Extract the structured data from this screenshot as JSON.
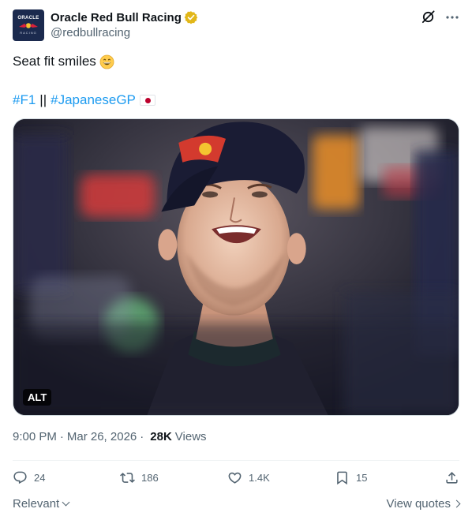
{
  "account": {
    "display_name": "Oracle Red Bull Racing",
    "handle": "@redbullracing",
    "avatar_text_top": "ORACLE",
    "avatar_text_bottom": "RACING",
    "verified": true,
    "verified_color": "#e2b719"
  },
  "header_icons": [
    "grok-icon",
    "more-icon"
  ],
  "tweet": {
    "text": "Seat fit smiles",
    "emoji": "grinning-face-emoji",
    "hashtags": [
      "#F1",
      "#JapaneseGP"
    ],
    "separator": "||",
    "flag": "japan-flag"
  },
  "media": {
    "alt_badge": "ALT"
  },
  "meta": {
    "time": "9:00 PM",
    "dot": "·",
    "date": "Mar 26, 2026",
    "views_count": "28K",
    "views_label": "Views"
  },
  "actions": {
    "replies": "24",
    "reposts": "186",
    "likes": "1.4K",
    "bookmarks": "15"
  },
  "footer": {
    "sort_label": "Relevant",
    "view_quotes_label": "View quotes"
  },
  "colors": {
    "link": "#1d9bf0",
    "text_primary": "#0f1419",
    "text_secondary": "#536471"
  }
}
